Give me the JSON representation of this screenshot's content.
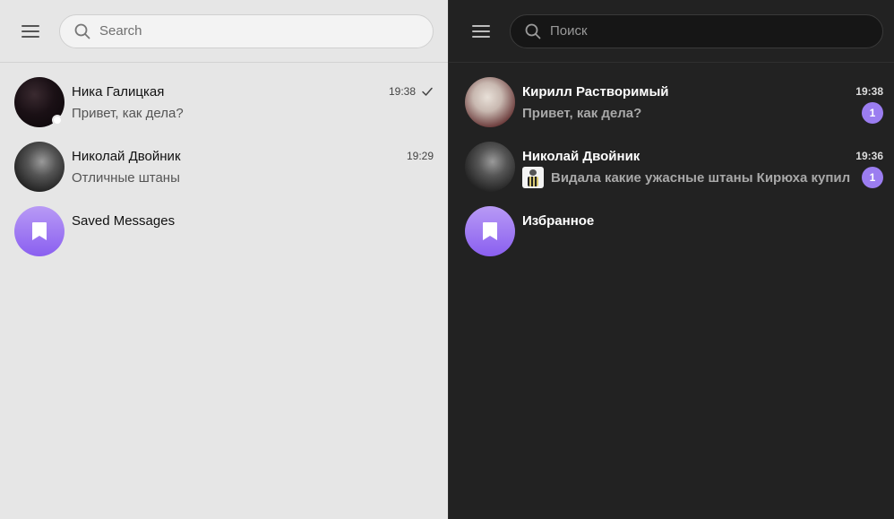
{
  "light": {
    "search": {
      "placeholder": "Search"
    },
    "chats": [
      {
        "name": "Ника Галицкая",
        "time": "19:38",
        "preview": "Привет, как дела?",
        "read": true,
        "online": true
      },
      {
        "name": "Николай Двойник",
        "time": "19:29",
        "preview": "Отличные штаны"
      },
      {
        "name": "Saved Messages",
        "time": "",
        "preview": ""
      }
    ]
  },
  "dark": {
    "search": {
      "placeholder": "Поиск"
    },
    "chats": [
      {
        "name": "Кирилл Растворимый",
        "time": "19:38",
        "preview": "Привет, как дела?",
        "unread": "1"
      },
      {
        "name": "Николай Двойник",
        "time": "19:36",
        "preview": "Видала какие ужасные штаны Кирюха купил",
        "unread": "1"
      },
      {
        "name": "Избранное",
        "time": "",
        "preview": ""
      }
    ]
  },
  "icons": {
    "menu": "hamburger-menu-icon",
    "search": "search-icon",
    "check": "check-icon",
    "saved": "bookmark-icon"
  },
  "colors": {
    "accent": "#9b7df0",
    "saved_gradient_top": "#b89af5",
    "saved_gradient_bottom": "#8a5ff0",
    "light_bg": "#e6e6e6",
    "dark_bg": "#222222"
  }
}
